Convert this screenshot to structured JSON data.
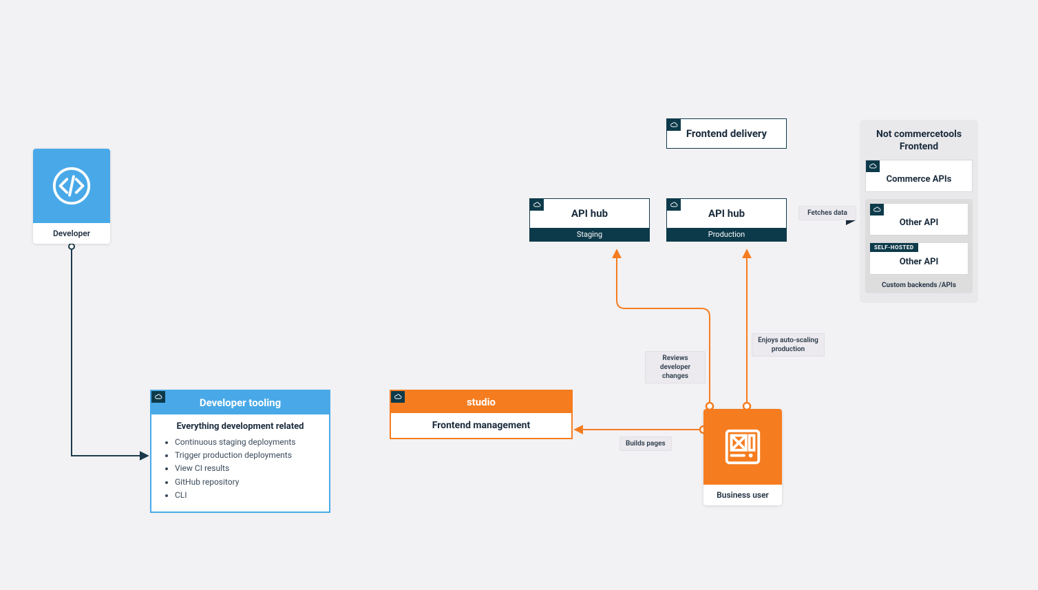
{
  "developer": {
    "label": "Developer"
  },
  "tooling": {
    "title": "Developer tooling",
    "subtitle": "Everything development related",
    "items": [
      "Continuous staging deployments",
      "Trigger production deployments",
      "View CI results",
      "GitHub repository",
      "CLI"
    ]
  },
  "frontend_delivery": {
    "title": "Frontend delivery"
  },
  "api_hub_staging": {
    "title": "API hub",
    "env": "Staging"
  },
  "api_hub_production": {
    "title": "API hub",
    "env": "Production"
  },
  "studio": {
    "title": "studio",
    "subtitle": "Frontend management"
  },
  "business_user": {
    "label": "Business user"
  },
  "annotations": {
    "fetches_data": "Fetches data",
    "reviews_changes": "Reviews developer changes",
    "enjoys_scaling": "Enjoys auto-scaling production",
    "builds_pages": "Builds pages"
  },
  "right_panel": {
    "heading": "Not commercetools Frontend",
    "commerce_apis": "Commerce APIs",
    "other_api": "Other API",
    "self_hosted_badge": "SELF-HOSTED",
    "other_api_self": "Other API",
    "custom_backends": "Custom backends /APIs"
  }
}
